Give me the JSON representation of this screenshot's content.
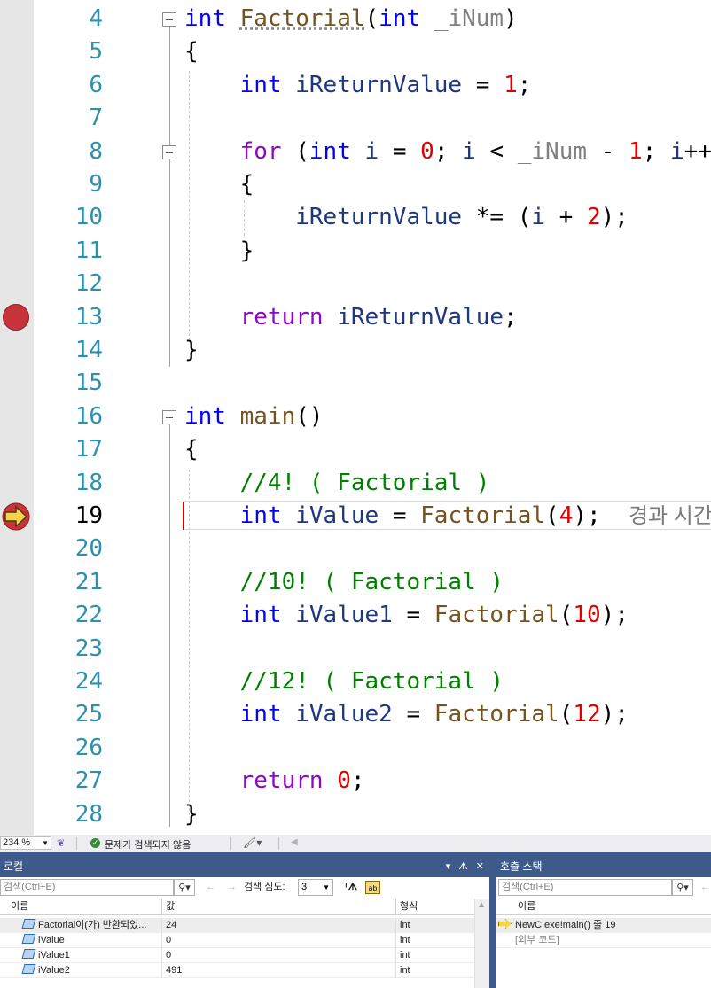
{
  "editor": {
    "lines": [
      {
        "n": "4"
      },
      {
        "n": "5"
      },
      {
        "n": "6"
      },
      {
        "n": "7"
      },
      {
        "n": "8"
      },
      {
        "n": "9"
      },
      {
        "n": "10"
      },
      {
        "n": "11"
      },
      {
        "n": "12"
      },
      {
        "n": "13"
      },
      {
        "n": "14"
      },
      {
        "n": "15"
      },
      {
        "n": "16"
      },
      {
        "n": "17"
      },
      {
        "n": "18"
      },
      {
        "n": "19"
      },
      {
        "n": "20"
      },
      {
        "n": "21"
      },
      {
        "n": "22"
      },
      {
        "n": "23"
      },
      {
        "n": "24"
      },
      {
        "n": "25"
      },
      {
        "n": "26"
      },
      {
        "n": "27"
      },
      {
        "n": "28"
      }
    ],
    "tokens": {
      "int": "int",
      "factorial": "Factorial",
      "lp": "(",
      "rp": ")",
      "param": "_iNum",
      "lbrace": "{",
      "rbrace": "}",
      "ireturn": "iReturnValue",
      "eq": " = ",
      "one": "1",
      "semi": ";",
      "for": "for",
      "i": "i",
      "zero": "0",
      "lt": " < ",
      "minus": " - ",
      "inc": "++",
      "muleq": " *= ",
      "plus": " + ",
      "two": "2",
      "return": "return",
      "main": "main",
      "cm4": "//4! ( Factorial )",
      "cm10": "//10! ( Factorial )",
      "cm12": "//12! ( Factorial )",
      "ivalue": "iValue",
      "ivalue1": "iValue1",
      "ivalue2": "iValue2",
      "four": "4",
      "ten": "10",
      "twelve": "12",
      "hint": "경과 시간"
    }
  },
  "statusbar": {
    "zoom": "234 %",
    "issues": "문제가 검색되지 않음"
  },
  "locals": {
    "title": "로컬",
    "search_placeholder": "검색(Ctrl+E)",
    "depth_label": "검색 심도:",
    "depth_value": "3",
    "columns": [
      "이름",
      "값",
      "형식"
    ],
    "rows": [
      {
        "name": "Factorial이(가) 반환되었...",
        "value": "24",
        "type": "int"
      },
      {
        "name": "iValue",
        "value": "0",
        "type": "int"
      },
      {
        "name": "iValue1",
        "value": "0",
        "type": "int"
      },
      {
        "name": "iValue2",
        "value": "491",
        "type": "int"
      }
    ]
  },
  "callstack": {
    "title": "호출 스택",
    "search_placeholder": "검색(Ctrl+E)",
    "columns": [
      "이름"
    ],
    "rows": [
      {
        "name": "NewC.exe!main() 줄 19"
      },
      {
        "name": "[외부 코드]"
      }
    ]
  },
  "colors": {
    "keyword": "#0000ff",
    "control": "#8f08c4",
    "function": "#74531f",
    "number": "#e00000",
    "identifier": "#1f377f",
    "comment": "#008000",
    "breakpoint": "#c8343c",
    "panel_title": "#3e5a8a"
  }
}
